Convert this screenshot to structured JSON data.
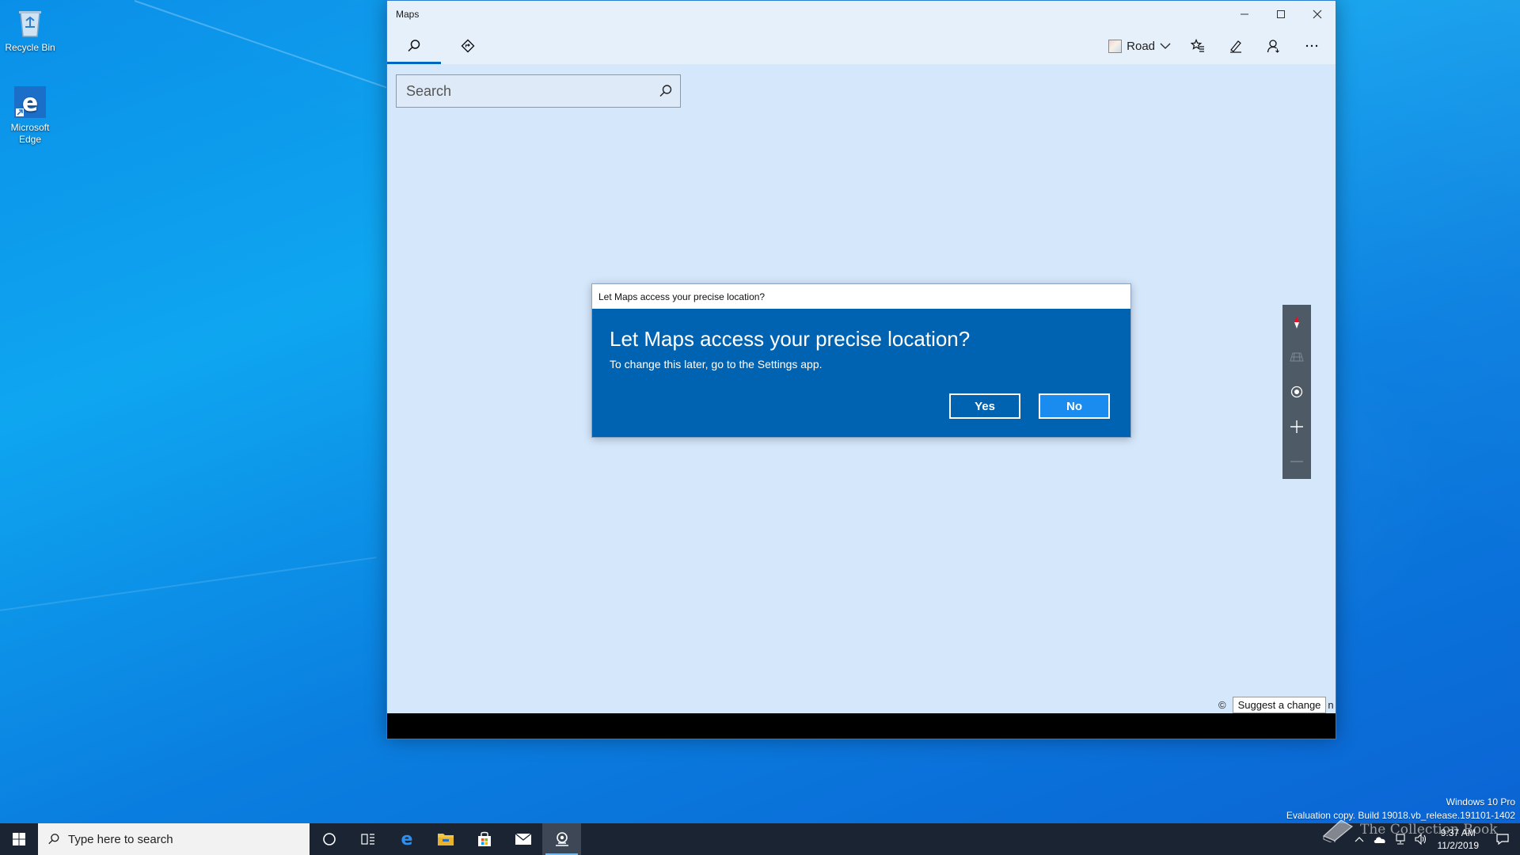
{
  "desktop": {
    "icons": [
      {
        "label": "Recycle Bin",
        "icon": "recycle-bin-icon"
      },
      {
        "label": "Microsoft Edge",
        "icon": "edge-icon"
      }
    ]
  },
  "window": {
    "title": "Maps",
    "toolbar": {
      "tabs": [
        {
          "name": "search",
          "icon": "search-icon",
          "active": true
        },
        {
          "name": "directions",
          "icon": "directions-icon",
          "active": false
        }
      ],
      "map_style_label": "Road",
      "buttons": [
        "favorites-icon",
        "ink-icon",
        "account-icon",
        "more-icon"
      ]
    },
    "search": {
      "placeholder": "Search",
      "value": ""
    },
    "map_controls": [
      "compass-icon",
      "tilt-icon",
      "my-location-icon",
      "zoom-in-icon",
      "zoom-out-icon"
    ],
    "footer": {
      "copyright_prefix": "©",
      "suggest_label": "Suggest a change",
      "suffix": "n"
    }
  },
  "dialog": {
    "title": "Let Maps access your precise location?",
    "heading": "Let Maps access your precise location?",
    "text": "To change this later, go to the Settings app.",
    "yes_label": "Yes",
    "no_label": "No"
  },
  "watermark": {
    "line1": "Windows 10 Pro",
    "line2": "Evaluation copy. Build 19018.vb_release.191101-1402"
  },
  "taskbar": {
    "search_placeholder": "Type here to search",
    "apps": [
      "cortana-icon",
      "task-view-icon",
      "edge-icon",
      "file-explorer-icon",
      "store-icon",
      "mail-icon",
      "maps-icon"
    ],
    "clock_time": "9:37 AM",
    "clock_date": "11/2/2019",
    "brand_text": "The Collection Book"
  },
  "colors": {
    "accent": "#0063b1",
    "dialog_no_button": "#1a8cf0",
    "taskbar": "#1b2433",
    "map_background": "#d5e7fb"
  }
}
